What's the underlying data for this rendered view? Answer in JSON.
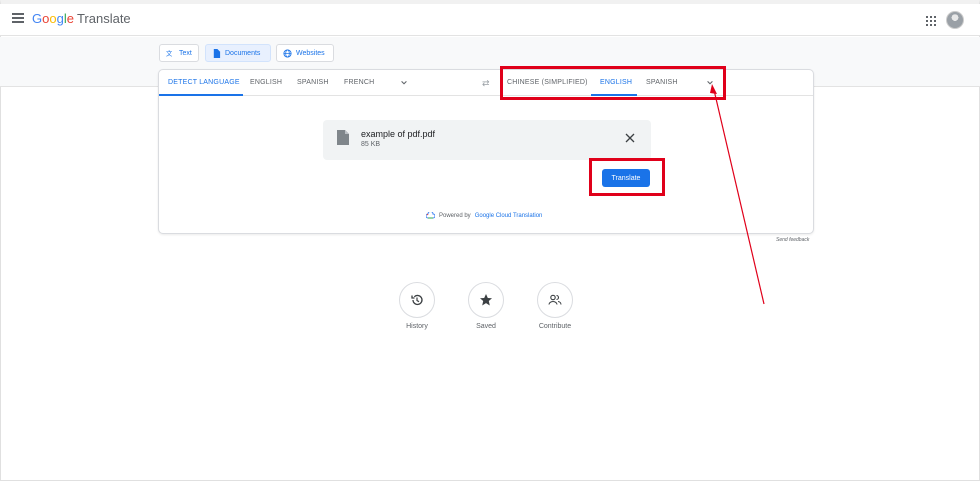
{
  "header": {
    "logo": {
      "g": "G",
      "o1": "o",
      "o2": "o",
      "g2": "g",
      "l": "l",
      "e": "e"
    },
    "product": "Translate"
  },
  "modes": [
    {
      "label": "Text",
      "active": false
    },
    {
      "label": "Documents",
      "active": true
    },
    {
      "label": "Websites",
      "active": false
    }
  ],
  "source_langs": [
    "DETECT LANGUAGE",
    "ENGLISH",
    "SPANISH",
    "FRENCH"
  ],
  "target_langs": [
    "CHINESE (SIMPLIFIED)",
    "ENGLISH",
    "SPANISH"
  ],
  "source_active": "DETECT LANGUAGE",
  "target_active": "ENGLISH",
  "file": {
    "name": "example of pdf.pdf",
    "size": "85 KB"
  },
  "translate_label": "Translate",
  "powered": {
    "prefix": "Powered by",
    "link": "Google Cloud Translation"
  },
  "send_feedback": "Send feedback",
  "quick": [
    {
      "label": "History",
      "icon": "history-icon"
    },
    {
      "label": "Saved",
      "icon": "star-icon"
    },
    {
      "label": "Contribute",
      "icon": "people-icon"
    }
  ],
  "colors": {
    "accent": "#1a73e8",
    "annotation": "#e0001a"
  }
}
